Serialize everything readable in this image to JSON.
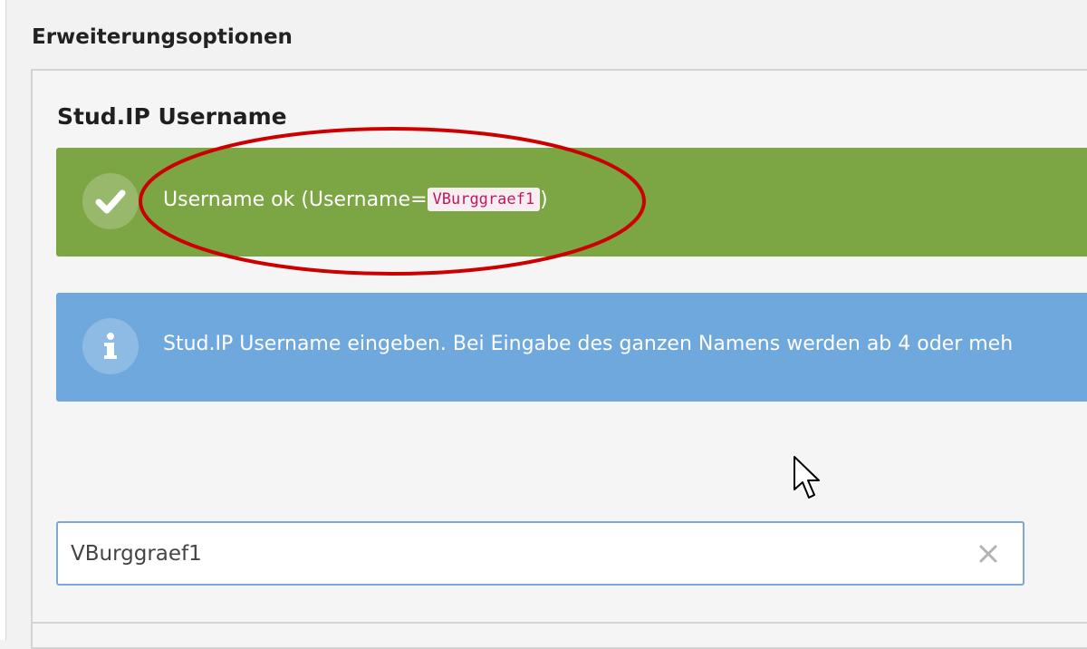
{
  "section": {
    "title": "Erweiterungsoptionen"
  },
  "field": {
    "label": "Stud.IP Username"
  },
  "success_alert": {
    "text_prefix": "Username ok (Username=",
    "username_code": "VBurggraef1",
    "text_suffix": ")",
    "icon": "checkmark-icon",
    "color": "#7ca543"
  },
  "info_alert": {
    "text": "Stud.IP Username eingeben. Bei Eingabe des ganzen Namens werden ab 4 oder meh",
    "icon": "info-icon",
    "color": "#6fa8dc"
  },
  "username_input": {
    "value": "VBurggraef1",
    "clear_icon": "clear-icon"
  },
  "colors": {
    "annotation": "#cc0000",
    "input_border": "#7fa6d6",
    "code_text": "#c2185b"
  }
}
